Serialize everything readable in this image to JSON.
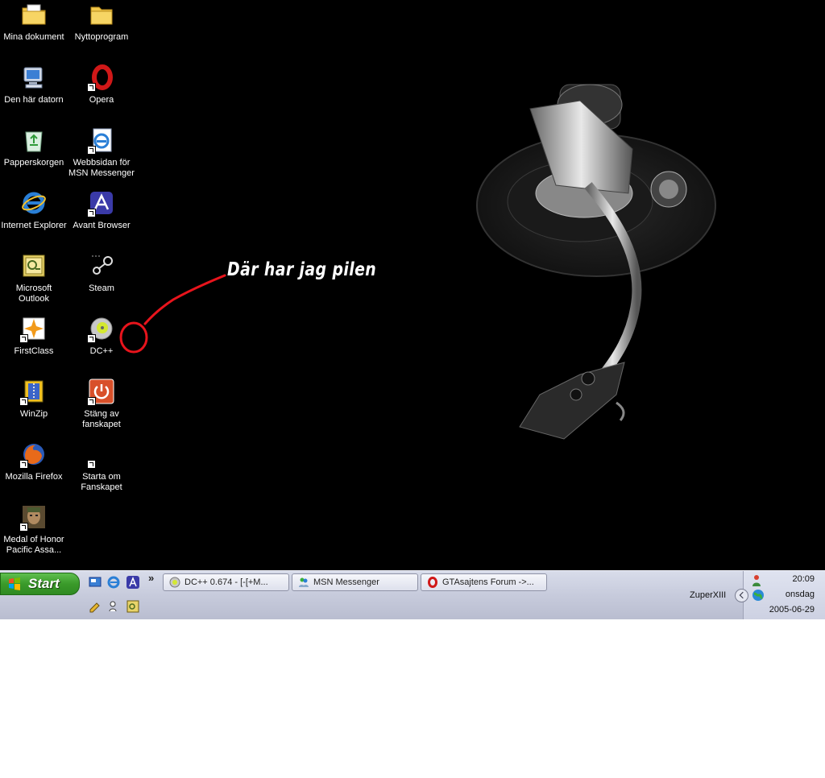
{
  "desktop": {
    "icons": [
      {
        "label": "Mina dokument"
      },
      {
        "label": "Nyttoprogram"
      },
      {
        "label": "Den här datorn"
      },
      {
        "label": "Opera"
      },
      {
        "label": "Papperskorgen"
      },
      {
        "label": "Webbsidan för MSN Messenger"
      },
      {
        "label": "Internet Explorer"
      },
      {
        "label": "Avant Browser"
      },
      {
        "label": "Microsoft Outlook"
      },
      {
        "label": "Steam"
      },
      {
        "label": "FirstClass"
      },
      {
        "label": "DC++"
      },
      {
        "label": "WinZip"
      },
      {
        "label": "Stäng av fanskapet"
      },
      {
        "label": "Mozilla Firefox"
      },
      {
        "label": "Starta om Fanskapet"
      },
      {
        "label": "Medal of Honor Pacific Assa..."
      }
    ],
    "annotation": "Där har jag pilen",
    "annotation_color": "#e8141c"
  },
  "taskbar": {
    "start_label": "Start",
    "quicklaunch_overflow": "»",
    "tasks": [
      {
        "label": "DC++ 0.674 - [-[+M..."
      },
      {
        "label": "MSN Messenger"
      },
      {
        "label": "GTAsajtens Forum ->..."
      }
    ],
    "user": "ZuperXIII",
    "clock": {
      "time": "20:09",
      "day": "onsdag",
      "date": "2005-06-29"
    }
  }
}
